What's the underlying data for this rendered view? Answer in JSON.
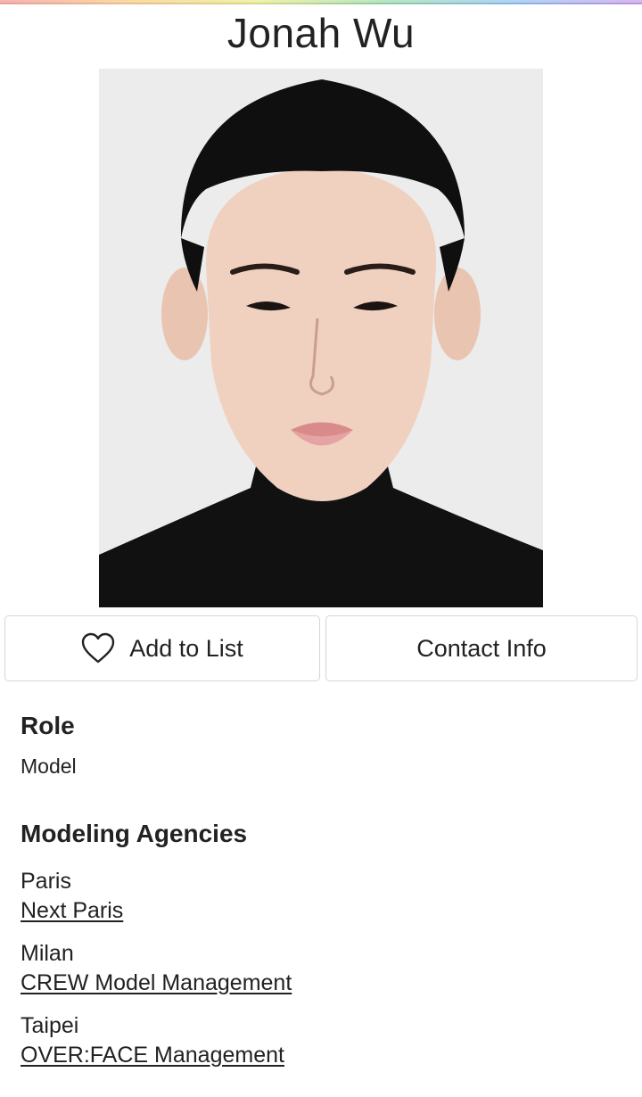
{
  "profile": {
    "name": "Jonah Wu",
    "photo_icon": "portrait-photo"
  },
  "actions": {
    "add_to_list_label": "Add to List",
    "add_to_list_icon": "heart-outline-icon",
    "contact_info_label": "Contact Info"
  },
  "role": {
    "heading": "Role",
    "value": "Model"
  },
  "agencies": {
    "heading": "Modeling Agencies",
    "items": [
      {
        "city": "Paris",
        "agency": "Next Paris"
      },
      {
        "city": "Milan",
        "agency": "CREW Model Management"
      },
      {
        "city": "Taipei",
        "agency": "OVER:FACE Management"
      }
    ]
  }
}
